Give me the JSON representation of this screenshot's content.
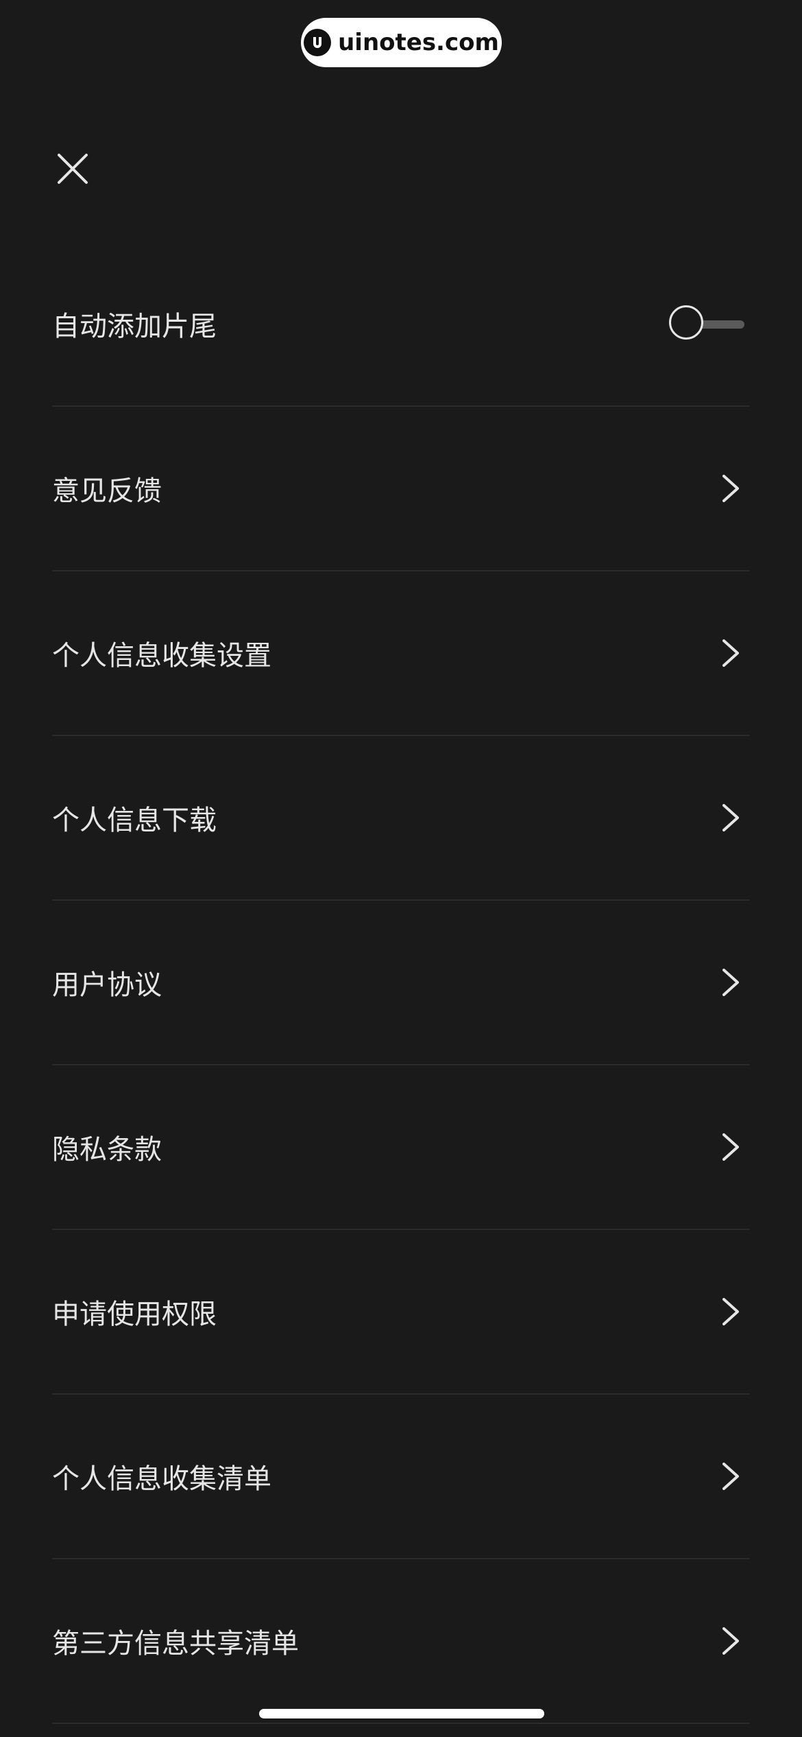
{
  "watermark": {
    "text": "uinotes.com",
    "logo_icon": "uinotes-logo-icon"
  },
  "header": {
    "close_icon": "close-icon"
  },
  "settings": {
    "items": [
      {
        "label": "自动添加片尾",
        "control": "toggle",
        "enabled": false
      },
      {
        "label": "意见反馈",
        "control": "chevron"
      },
      {
        "label": "个人信息收集设置",
        "control": "chevron"
      },
      {
        "label": "个人信息下载",
        "control": "chevron"
      },
      {
        "label": "用户协议",
        "control": "chevron"
      },
      {
        "label": "隐私条款",
        "control": "chevron"
      },
      {
        "label": "申请使用权限",
        "control": "chevron"
      },
      {
        "label": "个人信息收集清单",
        "control": "chevron"
      },
      {
        "label": "第三方信息共享清单",
        "control": "chevron"
      }
    ]
  },
  "colors": {
    "background": "#1a1a1a",
    "text": "#e6e6e6",
    "divider": "#2b2b2b"
  }
}
